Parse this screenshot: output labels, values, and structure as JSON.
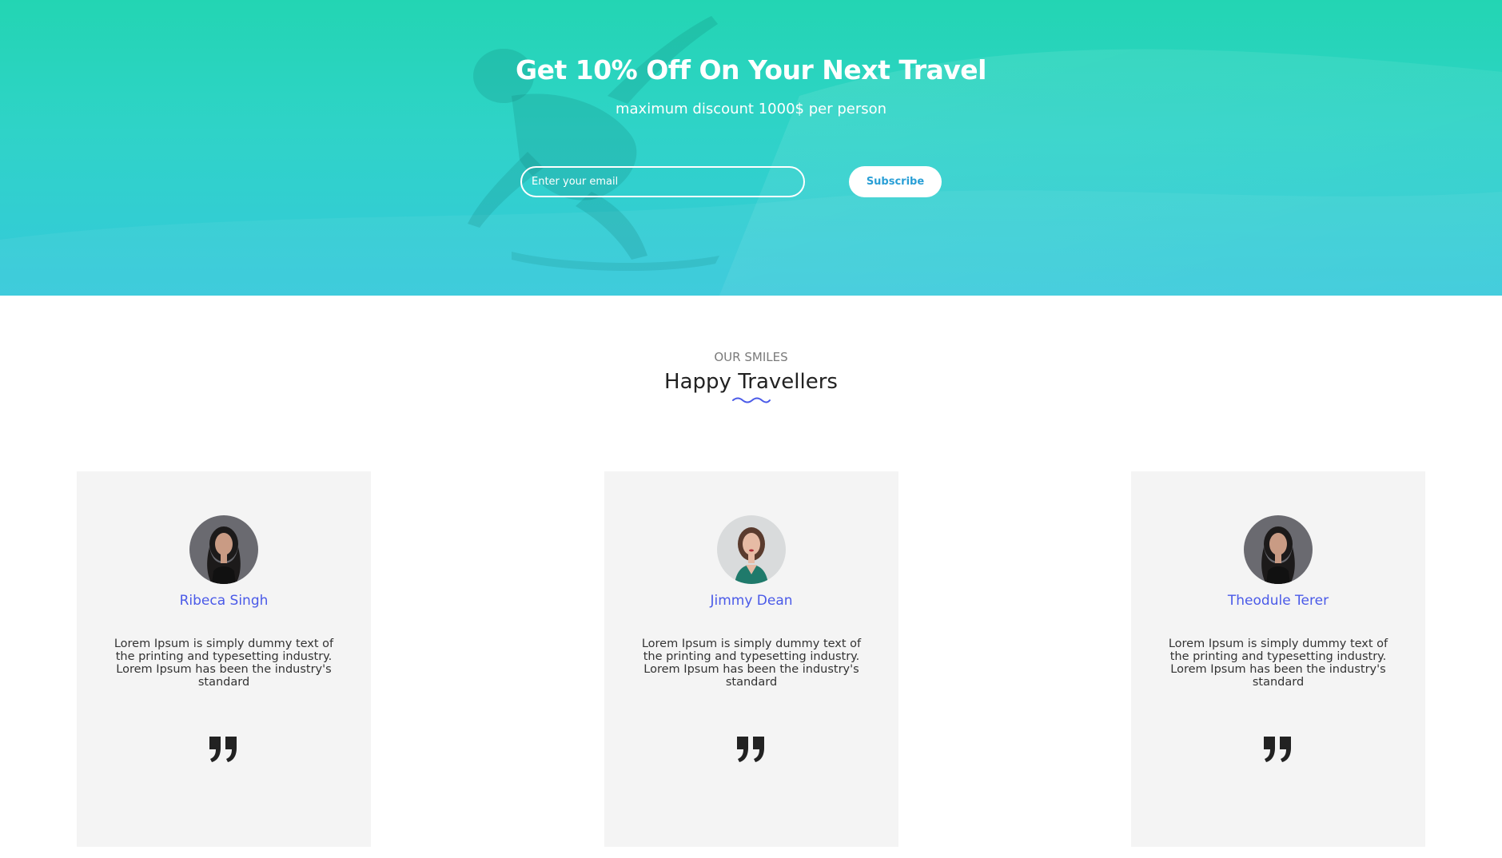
{
  "hero": {
    "title": "Get 10% Off On Your Next Travel",
    "subtitle": "maximum discount 1000$ per person",
    "email_placeholder": "Enter your email",
    "subscribe_label": "Subscribe"
  },
  "section": {
    "kicker": "OUR SMILES",
    "title": "Happy Travellers"
  },
  "testimonials": [
    {
      "name": "Ribeca Singh",
      "text": "Lorem Ipsum is simply dummy text of the printing and typesetting industry. Lorem Ipsum has been the industry's standard"
    },
    {
      "name": "Jimmy Dean",
      "text": "Lorem Ipsum is simply dummy text of the printing and typesetting industry. Lorem Ipsum has been the industry's standard"
    },
    {
      "name": "Theodule Terer",
      "text": "Lorem Ipsum is simply dummy text of the printing and typesetting industry. Lorem Ipsum has been the industry's standard"
    }
  ],
  "colors": {
    "accent": "#4a5ae8",
    "hero_gradient_top": "#23d5b3",
    "hero_gradient_bottom": "#35c9db",
    "subscribe_text": "#2a9fd6",
    "card_background": "#f4f4f4"
  },
  "icons": {
    "quote": "closing-quote-icon",
    "underline": "wave-underline-icon"
  }
}
